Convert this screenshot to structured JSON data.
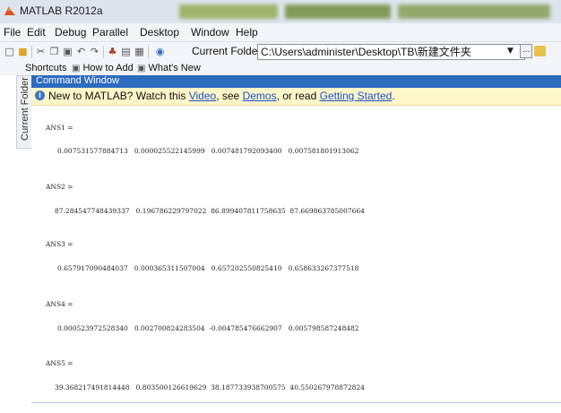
{
  "window": {
    "title": "MATLAB  R2012a",
    "logo_color": "#d9541e"
  },
  "menu": [
    {
      "label": "File"
    },
    {
      "label": "Edit"
    },
    {
      "label": "Debug"
    },
    {
      "label": "Parallel"
    },
    {
      "label": "Desktop"
    },
    {
      "label": "Window"
    },
    {
      "label": "Help"
    }
  ],
  "toolbar": {
    "current_folder_label": "Current Folder:",
    "current_folder_value": "C:\\Users\\administer\\Desktop\\TB\\新建文件夹",
    "browse_label": "..."
  },
  "shortcuts": [
    {
      "label": "Shortcuts"
    },
    {
      "label": "How to Add"
    },
    {
      "label": "What's New"
    }
  ],
  "side_tab": {
    "label": "Current Folder"
  },
  "command_window": {
    "title": "Command Window",
    "notice": {
      "prefix": "New to MATLAB? Watch this ",
      "video": "Video",
      "sep1": ", see ",
      "demos": "Demos",
      "sep2": ", or read ",
      "getting_started": "Getting Started",
      "suffix": "."
    },
    "outputs": [
      {
        "label": "ANS1 =",
        "values": "0.007531577884713   0.000025522145999   0.007481792093400   0.007581801913062"
      },
      {
        "label": "ANS2 =",
        "values": "87.284547748439337   0.196786229797022  86.899407811758635  87.669863785007664"
      },
      {
        "label": "ANS3 =",
        "values": "0.657917090484037   0.000365311507004   0.657202550825410   0.658633267377518"
      },
      {
        "label": "ANS4 =",
        "values": "0.000523972528340   0.002700824283504  -0.004785476662907   0.005798587248482"
      },
      {
        "label": "ANS5 =",
        "values": "39.368217491814448   0.803500126619629  38.187733938700575  40.550267978872824"
      }
    ]
  }
}
